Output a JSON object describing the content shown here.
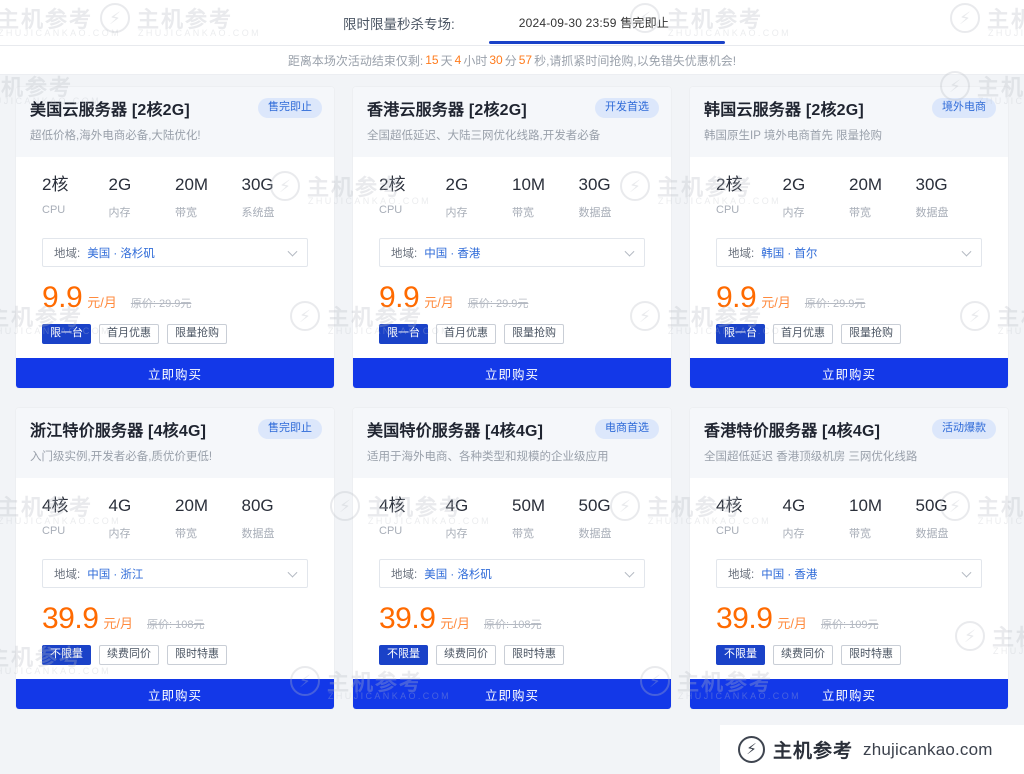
{
  "header": {
    "promo_label": "限时限量秒杀专场:",
    "tab_text": "2024-09-30 23:59 售完即止",
    "accent_color": "#1a42c8"
  },
  "countdown": {
    "prefix": "距离本场次活动结束仅剩:",
    "days": "15",
    "days_unit": "天",
    "hours": "4",
    "hours_unit": "小时",
    "minutes": "30",
    "minutes_unit": "分",
    "seconds": "57",
    "seconds_unit": "秒",
    "suffix": ",请抓紧时间抢购,以免错失优惠机会!",
    "highlight_color": "#ff7b1c"
  },
  "spec_labels": {
    "cpu": "CPU",
    "memory": "内存",
    "bandwidth": "带宽",
    "system_disk": "系统盘",
    "data_disk": "数据盘"
  },
  "region_prefix": "地域:",
  "buy_label": "立即购买",
  "price_unit": "元/月",
  "orig_prefix": "原价:",
  "cards": [
    {
      "title": "美国云服务器 [2核2G]",
      "subtitle": "超低价格,海外电商必备,大陆优化!",
      "badge": "售完即止",
      "specs": [
        {
          "value": "2核",
          "label": "CPU"
        },
        {
          "value": "2G",
          "label": "内存"
        },
        {
          "value": "20M",
          "label": "带宽"
        },
        {
          "value": "30G",
          "label": "系统盘"
        }
      ],
      "region": "美国 · 洛杉矶",
      "price": "9.9",
      "orig_price": "29.9元",
      "tags": [
        "限一台",
        "首月优惠",
        "限量抢购"
      ]
    },
    {
      "title": "香港云服务器 [2核2G]",
      "subtitle": "全国超低延迟、大陆三网优化线路,开发者必备",
      "badge": "开发首选",
      "specs": [
        {
          "value": "2核",
          "label": "CPU"
        },
        {
          "value": "2G",
          "label": "内存"
        },
        {
          "value": "10M",
          "label": "带宽"
        },
        {
          "value": "30G",
          "label": "数据盘"
        }
      ],
      "region": "中国 · 香港",
      "price": "9.9",
      "orig_price": "29.9元",
      "tags": [
        "限一台",
        "首月优惠",
        "限量抢购"
      ]
    },
    {
      "title": "韩国云服务器 [2核2G]",
      "subtitle": "韩国原生IP 境外电商首先 限量抢购",
      "badge": "境外电商",
      "specs": [
        {
          "value": "2核",
          "label": "CPU"
        },
        {
          "value": "2G",
          "label": "内存"
        },
        {
          "value": "20M",
          "label": "带宽"
        },
        {
          "value": "30G",
          "label": "数据盘"
        }
      ],
      "region": "韩国 · 首尔",
      "price": "9.9",
      "orig_price": "29.9元",
      "tags": [
        "限一台",
        "首月优惠",
        "限量抢购"
      ]
    },
    {
      "title": "浙江特价服务器 [4核4G]",
      "subtitle": "入门级实例,开发者必备,质优价更低!",
      "badge": "售完即止",
      "specs": [
        {
          "value": "4核",
          "label": "CPU"
        },
        {
          "value": "4G",
          "label": "内存"
        },
        {
          "value": "20M",
          "label": "带宽"
        },
        {
          "value": "80G",
          "label": "数据盘"
        }
      ],
      "region": "中国 · 浙江",
      "price": "39.9",
      "orig_price": "108元",
      "tags": [
        "不限量",
        "续费同价",
        "限时特惠"
      ]
    },
    {
      "title": "美国特价服务器 [4核4G]",
      "subtitle": "适用于海外电商、各种类型和规模的企业级应用",
      "badge": "电商首选",
      "specs": [
        {
          "value": "4核",
          "label": "CPU"
        },
        {
          "value": "4G",
          "label": "内存"
        },
        {
          "value": "50M",
          "label": "带宽"
        },
        {
          "value": "50G",
          "label": "数据盘"
        }
      ],
      "region": "美国 · 洛杉矶",
      "price": "39.9",
      "orig_price": "108元",
      "tags": [
        "不限量",
        "续费同价",
        "限时特惠"
      ]
    },
    {
      "title": "香港特价服务器 [4核4G]",
      "subtitle": "全国超低延迟 香港顶级机房 三网优化线路",
      "badge": "活动爆款",
      "specs": [
        {
          "value": "4核",
          "label": "CPU"
        },
        {
          "value": "4G",
          "label": "内存"
        },
        {
          "value": "10M",
          "label": "带宽"
        },
        {
          "value": "50G",
          "label": "数据盘"
        }
      ],
      "region": "中国 · 香港",
      "price": "39.9",
      "orig_price": "109元",
      "tags": [
        "不限量",
        "续费同价",
        "限时特惠"
      ]
    }
  ],
  "watermark": {
    "cn": "主机参考",
    "en": "ZHUJICANKAO.COM"
  },
  "brand_badge": {
    "cn": "主机参考",
    "url": "zhujicankao.com"
  }
}
